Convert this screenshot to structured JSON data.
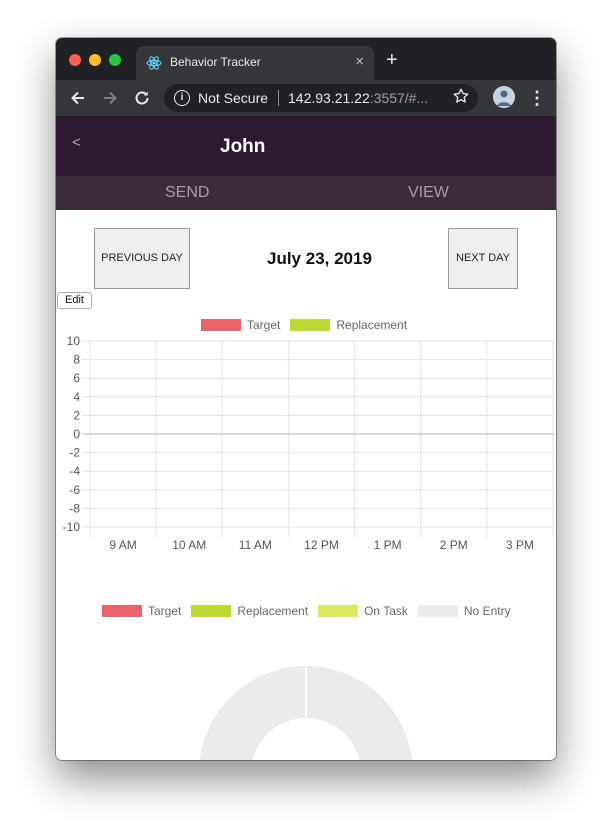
{
  "browser": {
    "tab_title": "Behavior Tracker",
    "tab_close": "×",
    "new_tab": "+",
    "security_label": "Not Secure",
    "url_host": "142.93.21.22",
    "url_rest": ":3557/#...",
    "icons": {
      "back": "arrow-left-icon",
      "forward": "arrow-right-icon",
      "reload": "reload-icon",
      "star": "star-icon",
      "menu": "kebab-menu-icon"
    }
  },
  "app": {
    "back_label": "<",
    "title": "John",
    "tabs": [
      {
        "label": "SEND"
      },
      {
        "label": "VIEW"
      }
    ],
    "colors": {
      "header": "#2c1a2e",
      "tabs_bar": "#3a2b3b"
    }
  },
  "day_nav": {
    "previous_label": "PREVIOUS DAY",
    "next_label": "NEXT DAY",
    "date": "July 23, 2019"
  },
  "edit_label": "Edit",
  "chart_data": [
    {
      "type": "bar",
      "legend": [
        {
          "name": "Target",
          "color": "#e8636b"
        },
        {
          "name": "Replacement",
          "color": "#bcd937"
        }
      ],
      "categories": [
        "9 AM",
        "10 AM",
        "11 AM",
        "12 PM",
        "1 PM",
        "2 PM",
        "3 PM"
      ],
      "series": [
        {
          "name": "Target",
          "values": []
        },
        {
          "name": "Replacement",
          "values": []
        }
      ],
      "yticks": [
        "10",
        "8",
        "6",
        "4",
        "2",
        "0",
        "-2",
        "-4",
        "-6",
        "-8",
        "-10"
      ],
      "ylim": [
        -10,
        10
      ],
      "grid": true,
      "legend_position": "top"
    },
    {
      "type": "pie",
      "legend": [
        {
          "name": "Target",
          "color": "#e8636b"
        },
        {
          "name": "Replacement",
          "color": "#bcd937"
        },
        {
          "name": "On Task",
          "color": "#dde85e"
        },
        {
          "name": "No Entry",
          "color": "#ebebeb"
        }
      ],
      "values": [
        0,
        0,
        0,
        1
      ],
      "legend_position": "top"
    }
  ]
}
